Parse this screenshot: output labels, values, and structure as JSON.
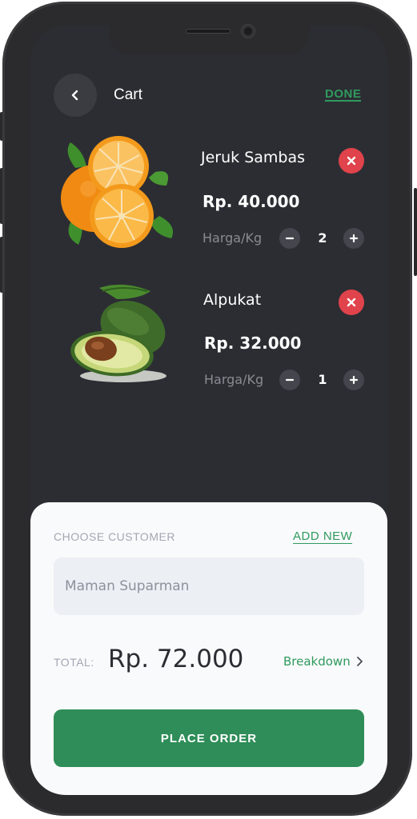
{
  "header": {
    "title": "Cart",
    "done_label": "DONE"
  },
  "cart": {
    "unit_label": "Harga/Kg",
    "items": [
      {
        "name": "Jeruk Sambas",
        "price": "Rp. 40.000",
        "quantity": "2",
        "image": "orange-image"
      },
      {
        "name": "Alpukat",
        "price": "Rp. 32.000",
        "quantity": "1",
        "image": "avocado-image"
      }
    ]
  },
  "customer": {
    "section_label": "CHOOSE CUSTOMER",
    "add_new_label": "ADD NEW",
    "selected_value": "Maman Suparman"
  },
  "total": {
    "label": "TOTAL:",
    "value": "Rp. 72.000",
    "breakdown_label": "Breakdown"
  },
  "actions": {
    "place_order_label": "PLACE ORDER"
  },
  "colors": {
    "accent": "#2e8d58",
    "remove": "#e0434b",
    "background": "#2c2d33",
    "sheet": "#f9fafb"
  }
}
